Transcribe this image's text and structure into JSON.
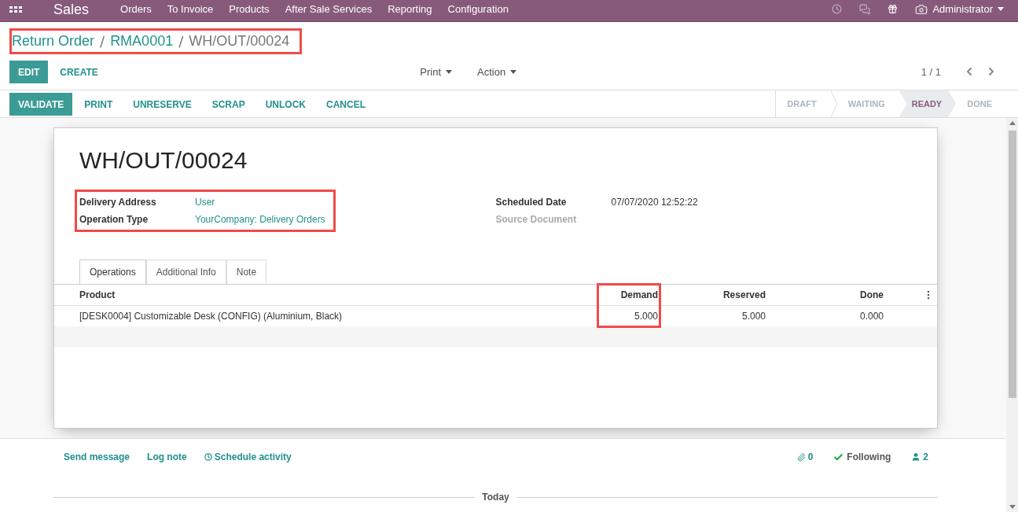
{
  "navbar": {
    "app": "Sales",
    "menu": [
      "Orders",
      "To Invoice",
      "Products",
      "After Sale Services",
      "Reporting",
      "Configuration"
    ],
    "user": "Administrator"
  },
  "breadcrumb_separator": "/",
  "breadcrumb": [
    {
      "label": "Return Order",
      "link": true
    },
    {
      "label": "RMA0001",
      "link": true
    },
    {
      "label": "WH/OUT/00024",
      "link": false
    }
  ],
  "highlights": {
    "breadcrumb": true,
    "fields": true,
    "demand": true
  },
  "actions": {
    "main": [
      {
        "label": "EDIT",
        "primary": true
      },
      {
        "label": "CREATE",
        "primary": false
      }
    ],
    "dropdowns": [
      "Print",
      "Action"
    ],
    "pager": "1 / 1"
  },
  "header_buttons": [
    {
      "label": "VALIDATE",
      "primary": true
    },
    {
      "label": "PRINT",
      "primary": false
    },
    {
      "label": "UNRESERVE",
      "primary": false
    },
    {
      "label": "SCRAP",
      "primary": false
    },
    {
      "label": "UNLOCK",
      "primary": false
    },
    {
      "label": "CANCEL",
      "primary": false
    }
  ],
  "statuses": [
    {
      "label": "DRAFT",
      "selected": false
    },
    {
      "label": "WAITING",
      "selected": false
    },
    {
      "label": "READY",
      "selected": true
    },
    {
      "label": "DONE",
      "selected": false
    }
  ],
  "form": {
    "title": "WH/OUT/00024",
    "left_fields": [
      {
        "label": "Delivery Address",
        "value": "User"
      },
      {
        "label": "Operation Type",
        "value": "YourCompany: Delivery Orders"
      }
    ],
    "right_fields": [
      {
        "label": "Scheduled Date",
        "value": "07/07/2020 12:52:22",
        "muted": false
      },
      {
        "label": "Source Document",
        "muted": true
      }
    ],
    "tabs": [
      {
        "label": "Operations",
        "selected": true
      },
      {
        "label": "Additional Info",
        "selected": false
      },
      {
        "label": "Note",
        "selected": false
      }
    ],
    "table": {
      "columns": [
        "Product",
        "Demand",
        "Reserved",
        "Done"
      ],
      "rows": [
        [
          "[DESK0004] Customizable Desk (CONFIG) (Aluminium, Black)",
          "5.000",
          "5.000",
          "0.000"
        ]
      ]
    }
  },
  "chatter": {
    "actions": [
      "Send message",
      "Log note",
      "Schedule activity"
    ],
    "attachments": "0",
    "follow": "Following",
    "followers": "2",
    "separator": "Today"
  }
}
